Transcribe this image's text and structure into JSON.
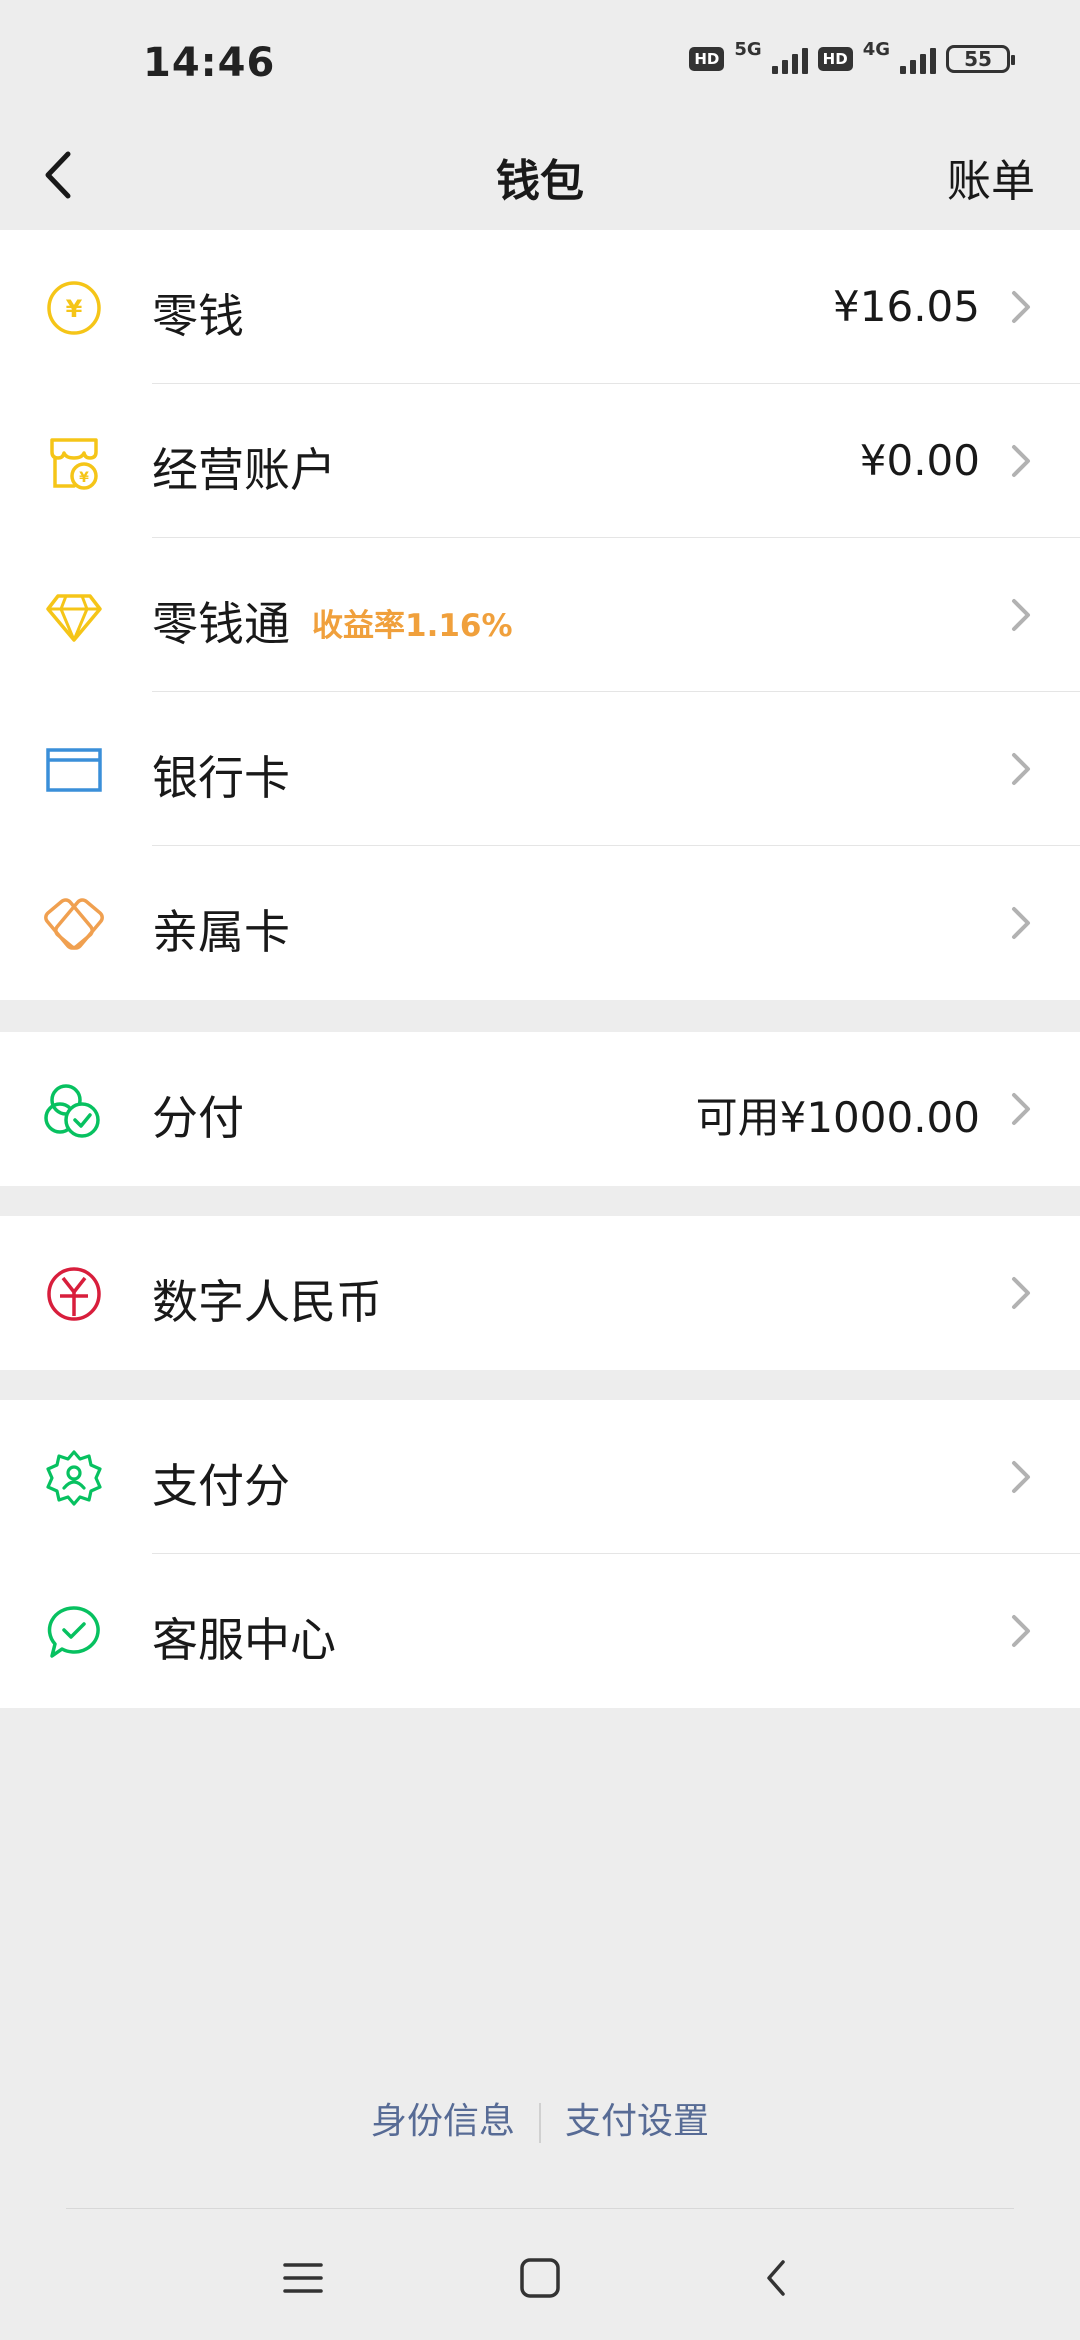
{
  "status_bar": {
    "time": "14:46",
    "sim1_hd": "HD",
    "sim1_network": "5G",
    "sim2_hd": "HD",
    "sim2_network": "4G",
    "battery": "55"
  },
  "header": {
    "title": "钱包",
    "right_action": "账单",
    "back_icon": "chevron-left-icon"
  },
  "groups": [
    {
      "items": [
        {
          "id": "change",
          "label": "零钱",
          "value": "¥16.05",
          "icon": "yen-coin-icon",
          "icon_color": "#f5c518"
        },
        {
          "id": "business-account",
          "label": "经营账户",
          "value": "¥0.00",
          "icon": "shop-yen-icon",
          "icon_color": "#f5c518"
        },
        {
          "id": "lingqiantong",
          "label": "零钱通",
          "badge": "收益率1.16%",
          "icon": "diamond-icon",
          "icon_color": "#f5c518"
        },
        {
          "id": "bank-card",
          "label": "银行卡",
          "icon": "bank-card-icon",
          "icon_color": "#3a8fd9"
        },
        {
          "id": "family-card",
          "label": "亲属卡",
          "icon": "family-card-icon",
          "icon_color": "#f0a050"
        }
      ]
    },
    {
      "items": [
        {
          "id": "fenfu",
          "label": "分付",
          "value": "可用¥1000.00",
          "icon": "fenfu-circles-icon",
          "icon_color": "#07c160"
        }
      ]
    },
    {
      "items": [
        {
          "id": "digital-rmb",
          "label": "数字人民币",
          "icon": "digital-yuan-icon",
          "icon_color": "#d81e3c"
        }
      ]
    },
    {
      "items": [
        {
          "id": "pay-score",
          "label": "支付分",
          "icon": "badge-person-icon",
          "icon_color": "#07c160"
        },
        {
          "id": "customer-service",
          "label": "客服中心",
          "icon": "chat-check-icon",
          "icon_color": "#07c160"
        }
      ]
    }
  ],
  "footer": {
    "identity_info": "身份信息",
    "payment_settings": "支付设置"
  },
  "colors": {
    "background": "#ededed",
    "link": "#576b95",
    "badge": "#f0a03c"
  }
}
